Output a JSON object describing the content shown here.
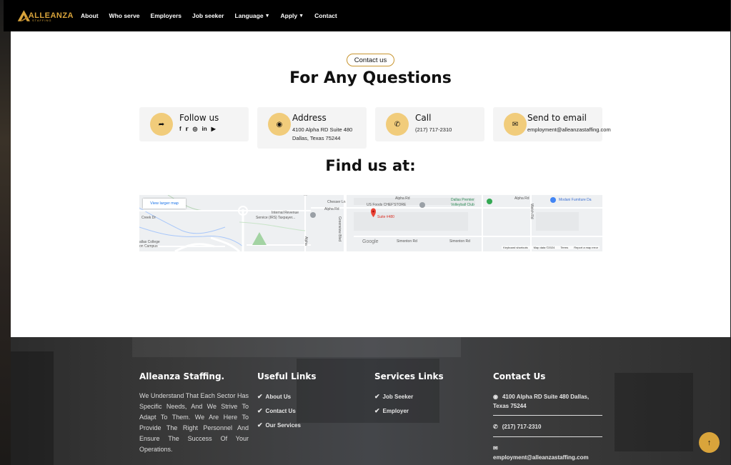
{
  "brand": {
    "name": "ALLEANZA",
    "tagline": "STAFFING"
  },
  "nav": {
    "items": [
      {
        "label": "About",
        "dropdown": false
      },
      {
        "label": "Who serve",
        "dropdown": false
      },
      {
        "label": "Employers",
        "dropdown": false
      },
      {
        "label": "Job seeker",
        "dropdown": false
      },
      {
        "label": "Language",
        "dropdown": true
      },
      {
        "label": "Apply",
        "dropdown": true
      },
      {
        "label": "Contact",
        "dropdown": false
      }
    ]
  },
  "contact_section": {
    "pill": "Contact us",
    "title": "For Any Questions",
    "find_title": "Find us at:",
    "cards": {
      "follow": {
        "title": "Follow us"
      },
      "address": {
        "title": "Address",
        "line1": "4100 Alpha RD Suite 480",
        "line2": "Dallas, Texas 75244"
      },
      "call": {
        "title": "Call",
        "line1": "(217) 717-2310"
      },
      "email": {
        "title": "Send to email",
        "line1": "employment@alleanzastaffing.com"
      }
    }
  },
  "map": {
    "view_larger": "View larger map",
    "labels": {
      "chesser": "Chesser Ln",
      "alpha1": "Alpha Rd",
      "alpha2": "Alpha Rd",
      "alpha3": "Alpha Rd",
      "us_foods": "US Foods CHEF'STORE",
      "dallas_premier": "Dallas Premier",
      "volleyball": "Volleyball Club",
      "modani": "Modani Furniture Da",
      "irs1": "Internal Revenue",
      "irs2": "Service (IRS) Taxpayer...",
      "suite": "Suite #480",
      "creek": "Creek Dr",
      "college1": "allas College",
      "college2": "on Campus",
      "simonton1": "Simonton Rd",
      "simonton2": "Simonton Rd",
      "greenview": "Greenview Blvd",
      "welch": "Welch Rd",
      "alpha_vert": "Alpha"
    },
    "google": "Google",
    "footer_items": [
      "Keyboard shortcuts",
      "Map data ©2024",
      "Terms",
      "Report a map error"
    ]
  },
  "footer": {
    "about_title": "Alleanza Staffing.",
    "about_text": "We Understand That Each Sector Has Specific Needs, And We Strive To Adapt To Them. We Are Here To Provide The Right Personnel And Ensure The Success Of Your Operations.",
    "useful_title": "Useful Links",
    "useful_links": [
      "About Us",
      "Contact Us",
      "Our Services"
    ],
    "services_title": "Services Links",
    "services_links": [
      "Job Seeker",
      "Employer"
    ],
    "contact_title": "Contact Us",
    "address": "4100 Alpha RD Suite 480 Dallas, Texas 75244",
    "phone": "(217) 717-2310",
    "email": "employment@alleanzastaffing.com"
  },
  "colors": {
    "accent": "#d9a43b",
    "circle": "#f1cc7b",
    "card_bg": "#f4f4f4"
  },
  "icons": {
    "follow": "share-icon",
    "address": "map-pin-icon",
    "call": "phone-icon",
    "email": "envelope-icon",
    "back_to_top": "arrow-up-icon"
  }
}
